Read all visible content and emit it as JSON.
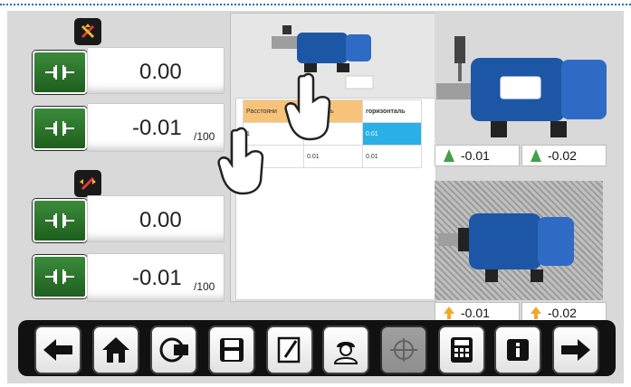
{
  "left_measurements": {
    "row1": {
      "value": "0.00",
      "unit": ""
    },
    "row2": {
      "value": "-0.01",
      "unit": "/100"
    },
    "row3": {
      "value": "0.00",
      "unit": ""
    },
    "row4": {
      "value": "-0.01",
      "unit": "/100"
    }
  },
  "table": {
    "headers": [
      "Расстояни",
      "ертикаль",
      "горизонталь"
    ],
    "rows": [
      [
        "1",
        "",
        "0.01"
      ],
      [
        "",
        "0.01",
        "0.01"
      ]
    ]
  },
  "right_readings": {
    "top_left": "-0.01",
    "top_right": "-0.02",
    "bottom_left": "-0.01",
    "bottom_right": "-0.02"
  },
  "colors": {
    "green": "#2e7d32",
    "blue_cell": "#2ab0e6",
    "toolbar": "#111111"
  },
  "toolbar_icons": [
    "back-arrow-icon",
    "home-icon",
    "reset-motor-icon",
    "save-icon",
    "notes-icon",
    "engineer-icon",
    "target-icon",
    "calculator-icon",
    "info-icon",
    "forward-arrow-icon"
  ]
}
